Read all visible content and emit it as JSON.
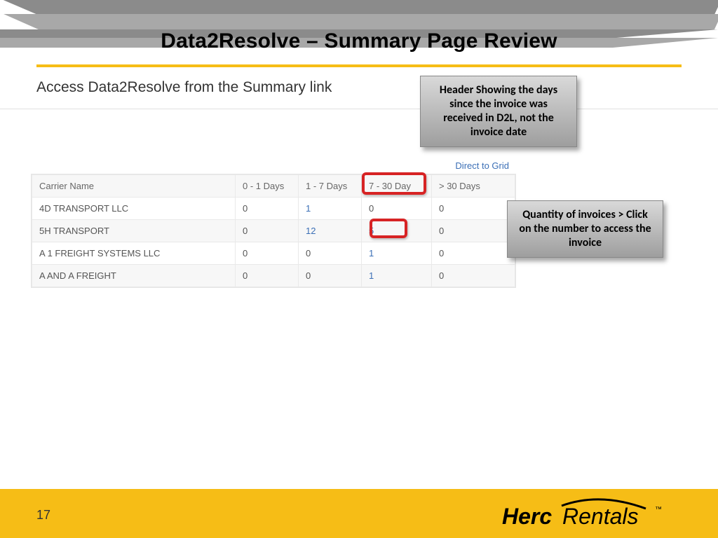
{
  "title": "Data2Resolve – Summary Page Review",
  "subtitle": "Access Data2Resolve from the Summary link",
  "direct_link": "Direct to Grid",
  "table": {
    "headers": [
      "Carrier Name",
      "0 - 1 Days",
      "1 - 7 Days",
      "7 - 30 Day",
      "> 30 Days"
    ],
    "rows": [
      {
        "name": "4D TRANSPORT LLC",
        "c0": "0",
        "c1": "1",
        "c2": "0",
        "c3": "0",
        "c1_link": true,
        "c2_link": false
      },
      {
        "name": "5H TRANSPORT",
        "c0": "0",
        "c1": "12",
        "c2": "5",
        "c3": "0",
        "c1_link": true,
        "c2_link": true
      },
      {
        "name": "A 1 FREIGHT SYSTEMS LLC",
        "c0": "0",
        "c1": "0",
        "c2": "1",
        "c3": "0",
        "c1_link": false,
        "c2_link": true
      },
      {
        "name": "A AND A FREIGHT",
        "c0": "0",
        "c1": "0",
        "c2": "1",
        "c3": "0",
        "c1_link": false,
        "c2_link": true
      }
    ]
  },
  "callout1": "Header Showing the days since the invoice was received in D2L, not the invoice date",
  "callout2": "Quantity of invoices > Click on the number to access the invoice",
  "page_number": "17",
  "logo": {
    "bold": "Herc",
    "italic": "Rentals",
    "tm": "™"
  }
}
